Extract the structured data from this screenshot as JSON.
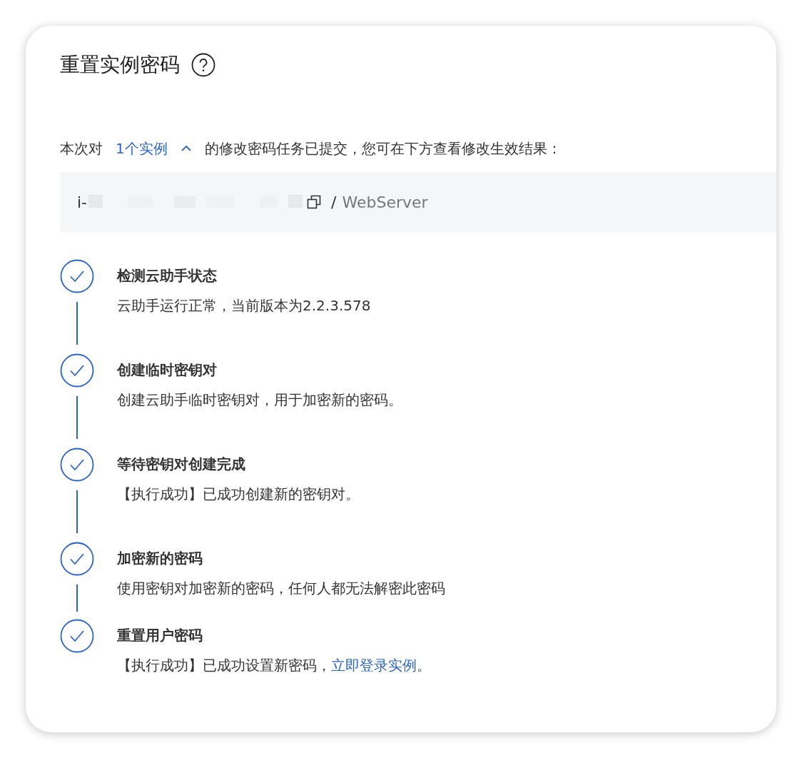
{
  "dialog": {
    "title": "重置实例密码"
  },
  "intro": {
    "before": "本次对",
    "toggle": "1个实例",
    "expanded": true,
    "after": "的修改密码任务已提交，您可在下方查看修改生效结果："
  },
  "instance": {
    "id_prefix": "i-",
    "separator": "/",
    "name": "WebServer"
  },
  "steps": [
    {
      "kind": "done",
      "title": "检测云助手状态",
      "description": [
        {
          "kind": "text",
          "text": "云助手运行正常，当前版本为2.2.3.578"
        }
      ]
    },
    {
      "kind": "done",
      "title": "创建临时密钥对",
      "description": [
        {
          "kind": "text",
          "text": "创建云助手临时密钥对，用于加密新的密码。"
        }
      ]
    },
    {
      "kind": "done",
      "title": "等待密钥对创建完成",
      "description": [
        {
          "kind": "text",
          "text": "【执行成功】已成功创建新的密钥对。"
        }
      ]
    },
    {
      "kind": "done",
      "title": "加密新的密码",
      "description": [
        {
          "kind": "text",
          "text": "使用密钥对加密新的密码，任何人都无法解密此密码"
        }
      ]
    },
    {
      "kind": "done",
      "title": "重置用户密码",
      "description": [
        {
          "kind": "text",
          "text": "【执行成功】已成功设置新密码，"
        },
        {
          "kind": "link",
          "text": "立即登录实例"
        },
        {
          "kind": "text",
          "text": "。"
        }
      ]
    }
  ]
}
